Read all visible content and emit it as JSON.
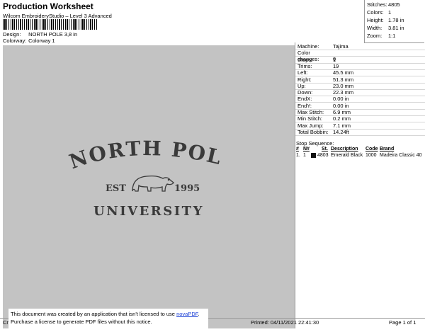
{
  "header": {
    "title": "Production Worksheet",
    "subtitle": "Wilcom EmbroideryStudio – Level 3 Advanced",
    "design_label": "Design:",
    "design_value": "NORTH POLE 3,8 in",
    "colorway_label": "Colorway:",
    "colorway_value": "Colorway 1"
  },
  "summary": {
    "stitches_label": "Stitches:",
    "stitches": "4805",
    "colors_label": "Colors:",
    "colors": "1",
    "height_label": "Height:",
    "height": "1.78 in",
    "width_label": "Width:",
    "width": "3.81 in",
    "zoom_label": "Zoom:",
    "zoom": "1:1"
  },
  "design": {
    "line1": "NORTH POLE",
    "est": "EST",
    "year": "1995",
    "line3": "UNIVERSITY",
    "thread_color": "#3a3a3a",
    "background_color": "#c3c3c3"
  },
  "properties": [
    {
      "k": "Machine:",
      "v": "Tajima"
    },
    {
      "k": "Color changes:",
      "v": "0"
    },
    {
      "k": "Stops:",
      "v": "1"
    },
    {
      "k": "Trims:",
      "v": "19"
    },
    {
      "k": "Left:",
      "v": "45.5 mm"
    },
    {
      "k": "Right:",
      "v": "51.3 mm"
    },
    {
      "k": "Up:",
      "v": "23.0 mm"
    },
    {
      "k": "Down:",
      "v": "22.3 mm"
    },
    {
      "k": "EndX:",
      "v": "0.00 in"
    },
    {
      "k": "EndY:",
      "v": "0.00 in"
    },
    {
      "k": "Max Stitch:",
      "v": "6.9 mm"
    },
    {
      "k": "Min Stitch:",
      "v": "0.2 mm"
    },
    {
      "k": "Max Jump:",
      "v": "7.1 mm"
    },
    {
      "k": "Total Bobbin:",
      "v": "14.24ft"
    }
  ],
  "stop_sequence": {
    "label": "Stop Sequence:",
    "columns": {
      "hash": "#",
      "n": "N#",
      "st": "St.",
      "desc": "Description",
      "code": "Code",
      "brand": "Brand"
    },
    "rows": [
      {
        "hash": "1.",
        "n": "1",
        "st": "4803",
        "desc": "Emerald Black",
        "code": "1000",
        "brand": "Madeira Classic 40"
      }
    ]
  },
  "notice": {
    "line1_prefix": "This document was created by an application that isn't licensed to use ",
    "link": "novaPDF",
    "line1_suffix": ".",
    "line2": "Purchase a license to generate PDF files without this notice."
  },
  "footer": {
    "left": "Cr",
    "printed": "Printed: 04/11/2021 22:41:30",
    "page": "Page 1 of 1"
  }
}
